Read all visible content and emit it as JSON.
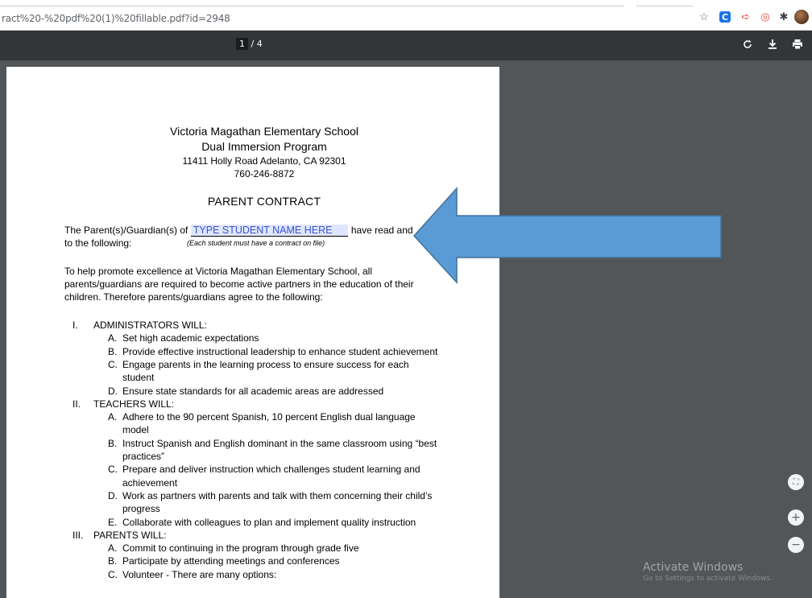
{
  "browser": {
    "url": "ract%20-%20pdf%20(1)%20fillable.pdf?id=2948"
  },
  "pdf_toolbar": {
    "page_current": "1",
    "page_total": "/ 4"
  },
  "document": {
    "school": "Victoria Magathan Elementary School",
    "program": "Dual Immersion Program",
    "address": "11411 Holly Road Adelanto, CA 92301",
    "phone": "760-246-8872",
    "title": "PARENT CONTRACT",
    "intro_prefix": "The Parent(s)/Guardian(s) of",
    "student_field_placeholder": "TYPE STUDENT NAME HERE",
    "intro_suffix": "have read and",
    "intro_line2": "to the following:",
    "intro_note": "(Each student must have a contract on file)",
    "para": [
      "To help promote excellence at Victoria Magathan Elementary School, all",
      "parents/guardians are required to become active partners in the education of their",
      "children. Therefore parents/guardians agree to the following:"
    ],
    "sections": [
      {
        "numeral": "I.",
        "heading": "ADMINISTRATORS WILL:",
        "items": [
          {
            "letter": "A.",
            "lines": [
              "Set high academic expectations"
            ]
          },
          {
            "letter": "B.",
            "lines": [
              "Provide effective instructional leadership to enhance student achievement"
            ]
          },
          {
            "letter": "C.",
            "lines": [
              "Engage parents in the learning process to ensure success for each",
              "student"
            ]
          },
          {
            "letter": "D.",
            "lines": [
              "Ensure state standards for all academic areas are addressed"
            ]
          }
        ]
      },
      {
        "numeral": "II.",
        "heading": "TEACHERS WILL:",
        "items": [
          {
            "letter": "A.",
            "lines": [
              "Adhere to the 90 percent Spanish, 10 percent English dual language",
              "model"
            ]
          },
          {
            "letter": "B.",
            "lines": [
              "Instruct Spanish and English dominant in the same classroom using “best",
              "practices”"
            ]
          },
          {
            "letter": "C.",
            "lines": [
              "Prepare and deliver instruction which challenges student learning and",
              "achievement"
            ]
          },
          {
            "letter": "D.",
            "lines": [
              "Work as partners with parents and talk with them concerning their child’s",
              "progress"
            ]
          },
          {
            "letter": "E.",
            "lines": [
              "Collaborate with colleagues to plan and implement quality instruction"
            ]
          }
        ]
      },
      {
        "numeral": "III.",
        "heading": "PARENTS WILL:",
        "items": [
          {
            "letter": "A.",
            "lines": [
              "Commit to continuing in the program through grade five"
            ]
          },
          {
            "letter": "B.",
            "lines": [
              "Participate by attending meetings and conferences"
            ]
          },
          {
            "letter": "C.",
            "lines": [
              "Volunteer - There are many options:"
            ]
          }
        ]
      }
    ]
  },
  "annotation": {
    "arrow_color": "#5b9bd5",
    "arrow_outline": "#41719c"
  },
  "windows_watermark": {
    "title": "Activate Windows",
    "subtitle": "Go to Settings to activate Windows."
  },
  "icons": [
    "star-icon",
    "extension-c-icon",
    "extension-arrow-icon",
    "extension-target-icon",
    "puzzle-icon",
    "avatar",
    "rotate-icon",
    "download-icon",
    "print-icon",
    "fit-page-icon",
    "zoom-in-icon",
    "zoom-out-icon"
  ]
}
